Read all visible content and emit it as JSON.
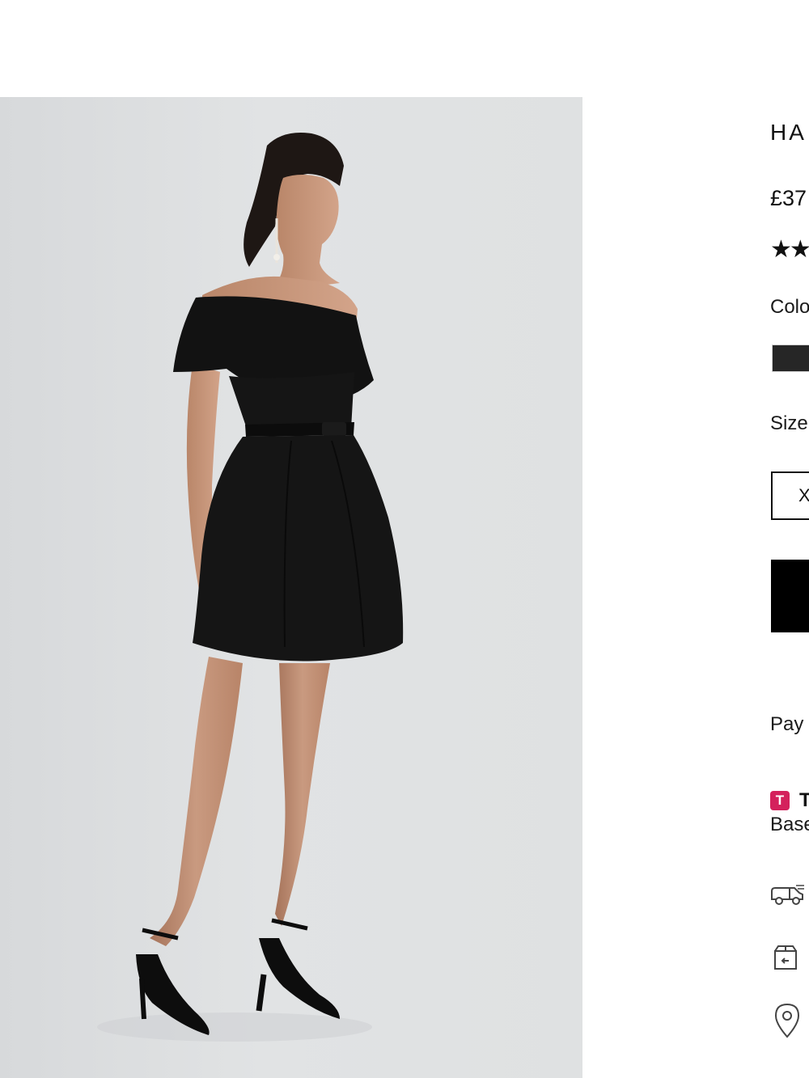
{
  "product": {
    "title": "HA",
    "price": "£37",
    "rating_stars": "★★",
    "rating": 2,
    "colour_label": "Colo",
    "selected_colour": "#262626",
    "size_label": "Size",
    "size_option": "X",
    "pay_text": "Pay",
    "badge_letter": "T",
    "badge_title": "T",
    "based_text": "Base"
  },
  "icons": [
    "delivery-truck-icon",
    "returns-box-icon",
    "location-pin-icon"
  ],
  "colors": {
    "accent": "#d4215c",
    "button": "#000000",
    "swatch": "#262626"
  }
}
